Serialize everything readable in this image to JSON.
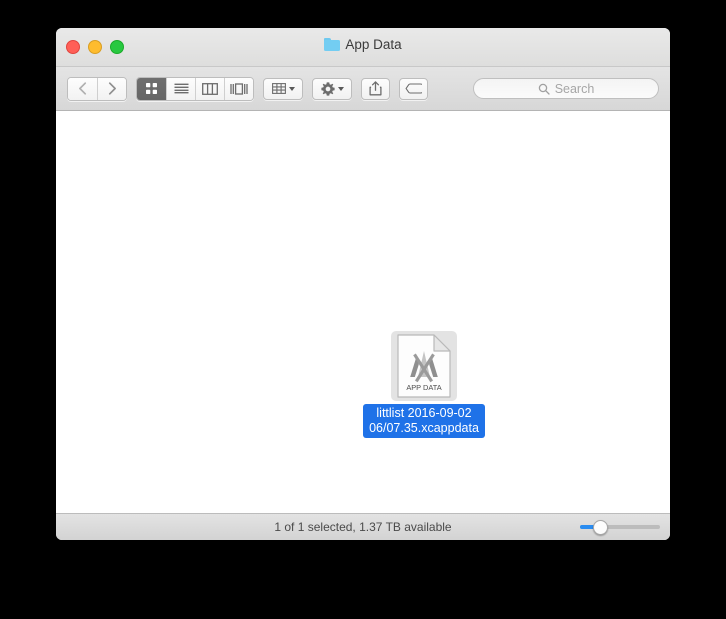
{
  "window": {
    "title": "App Data",
    "folder_icon": "folder-icon",
    "traffic_lights": {
      "close": "close-button",
      "minimize": "minimize-button",
      "maximize": "maximize-button"
    }
  },
  "toolbar": {
    "nav": {
      "back_label": "‹",
      "forward_label": "›"
    },
    "view_modes": [
      {
        "name": "icon-view",
        "selected": true
      },
      {
        "name": "list-view",
        "selected": false
      },
      {
        "name": "column-view",
        "selected": false
      },
      {
        "name": "gallery-view",
        "selected": false
      }
    ],
    "arrange_button": "arrange-button",
    "action_button": "action-button",
    "share_button": "share-button",
    "tag_button": "tag-button"
  },
  "search": {
    "placeholder": "Search",
    "value": "",
    "icon": "search-icon"
  },
  "files": [
    {
      "name": "littlist 2016-09-02 06/07.35.xcappdata",
      "icon_caption": "APP DATA",
      "selected": true
    }
  ],
  "statusbar": {
    "text": "1 of 1 selected, 1.37 TB available",
    "zoom_value": 24
  },
  "colors": {
    "selection_blue": "#1f72e8",
    "slider_blue": "#2a8cf0",
    "folder_blue": "#73cdf2",
    "selected_view_bg": "#6f6f6f"
  }
}
